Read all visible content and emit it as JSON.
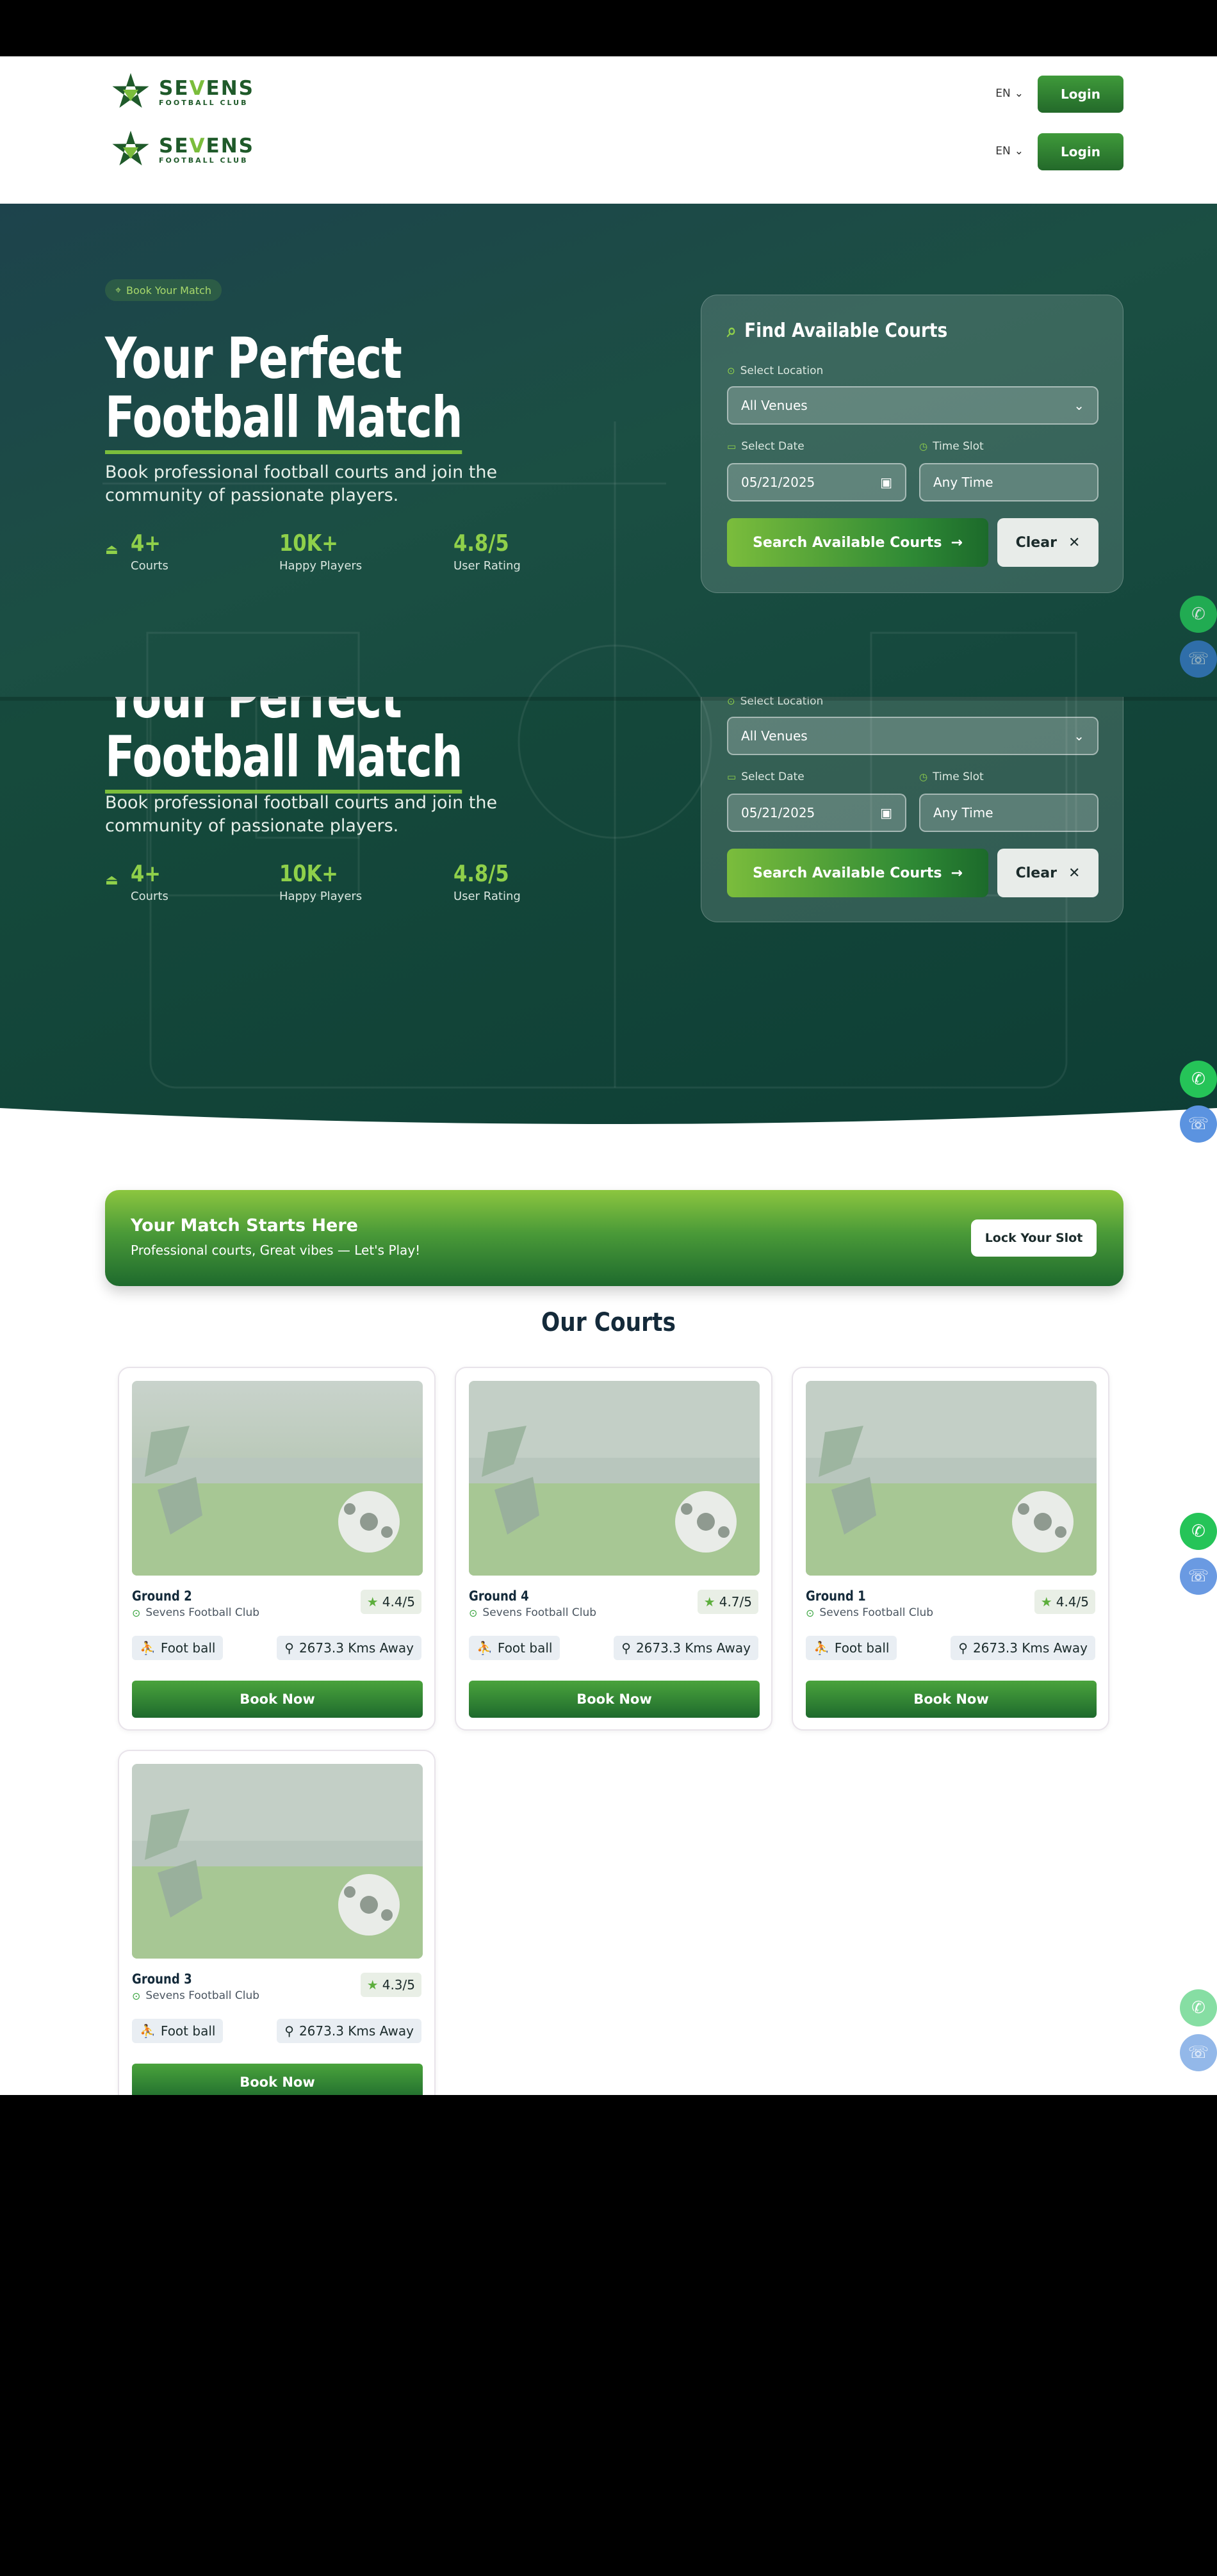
{
  "brand": {
    "name_part1": "SE",
    "name_v": "V",
    "name_part2": "ENS",
    "tagline": "FOOTBALL CLUB"
  },
  "header": {
    "lang": "EN",
    "login_label": "Login"
  },
  "hero": {
    "badge": "Book Your Match",
    "title_line1": "Your Perfect",
    "title_line2": "Football Match",
    "subtitle": "Book professional football courts and join the community of passionate players.",
    "stats": [
      {
        "value": "4+",
        "label": "Courts"
      },
      {
        "value": "10K+",
        "label": "Happy Players"
      },
      {
        "value": "4.8/5",
        "label": "User Rating"
      }
    ]
  },
  "finder": {
    "title": "Find Available Courts",
    "location_label": "Select Location",
    "location_value": "All Venues",
    "date_label": "Select Date",
    "date_value": "05/21/2025",
    "time_label": "Time Slot",
    "time_value": "Any Time",
    "search_label": "Search Available Courts",
    "clear_label": "Clear"
  },
  "banner": {
    "title": "Your Match Starts Here",
    "subtitle": "Professional courts, Great vibes — Let's Play!",
    "button": "Lock Your Slot"
  },
  "courts": {
    "title": "Our Courts",
    "items": [
      {
        "name": "Ground 2",
        "club": "Sevens Football Club",
        "rating": "4.4/5",
        "sport": "Foot ball",
        "distance": "2673.3 Kms Away",
        "book": "Book Now"
      },
      {
        "name": "Ground 4",
        "club": "Sevens Football Club",
        "rating": "4.7/5",
        "sport": "Foot ball",
        "distance": "2673.3 Kms Away",
        "book": "Book Now"
      },
      {
        "name": "Ground 1",
        "club": "Sevens Football Club",
        "rating": "4.4/5",
        "sport": "Foot ball",
        "distance": "2673.3 Kms Away",
        "book": "Book Now"
      },
      {
        "name": "Ground 3",
        "club": "Sevens Football Club",
        "rating": "4.3/5",
        "sport": "Foot ball",
        "distance": "2673.3 Kms Away",
        "book": "Book Now"
      }
    ]
  },
  "icons": {
    "whatsapp": "whatsapp-icon",
    "phone": "phone-icon"
  },
  "colors": {
    "brand_green": "#1f5a2a",
    "accent_green": "#7bbd3c",
    "hero_bg": "#164a3c"
  }
}
